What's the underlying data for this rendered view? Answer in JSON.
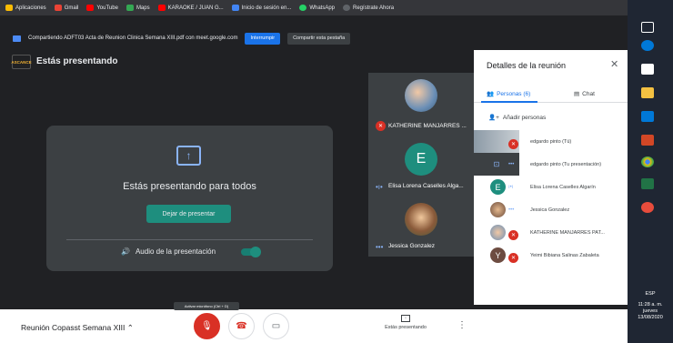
{
  "bookmarks": [
    {
      "label": "Aplicaciones",
      "icon": "apps-grid-icon",
      "color": "#fbbc04"
    },
    {
      "label": "Gmail",
      "icon": "gmail-icon",
      "color": "#ea4335"
    },
    {
      "label": "YouTube",
      "icon": "youtube-icon",
      "color": "#ff0000"
    },
    {
      "label": "Maps",
      "icon": "maps-icon",
      "color": "#34a853"
    },
    {
      "label": "KARAOKE / JUAN G...",
      "icon": "youtube-icon",
      "color": "#ff0000"
    },
    {
      "label": "Inicio de sesión en...",
      "icon": "site-icon",
      "color": "#4285f4"
    },
    {
      "label": "WhatsApp",
      "icon": "whatsapp-icon",
      "color": "#25d366"
    },
    {
      "label": "Regístrate Ahora",
      "icon": "site-icon",
      "color": "#5f6368"
    }
  ],
  "infobar": {
    "message": "Compartiendo ADFT03 Acta de Reunion Clinica Semana XIII.pdf con meet.google.com",
    "stop_label": "Interrumpir",
    "share_tab_label": "Compartir esta pestaña"
  },
  "stage": {
    "brand_label": "ASCANCE",
    "title": "Estás presentando",
    "present_message": "Estás presentando para todos",
    "stop_button": "Dejar de presentar",
    "audio_label": "Audio de la presentación"
  },
  "tiles": [
    {
      "name": "KATHERINE MANJARRES ...",
      "status": "muted"
    },
    {
      "name": "Elisa Lorena Caselles Alga...",
      "initial": "E",
      "status": "speaking"
    },
    {
      "name": "Jessica Gonzalez",
      "status": "active"
    }
  ],
  "panel": {
    "title": "Detalles de la reunión",
    "tab_people": "Personas (6)",
    "tab_chat": "Chat",
    "add_people": "Añadir personas",
    "participants": [
      {
        "name": "edgardo pinto (Tú)",
        "status": "muted"
      },
      {
        "name": "edgardo pinto (Tu presentación)",
        "status": "active"
      },
      {
        "name": "Elisa Lorena Caselles Algarín",
        "initial": "E",
        "status": "speaking"
      },
      {
        "name": "Jessica Gonzalez",
        "status": "active"
      },
      {
        "name": "KATHERINE MANJARRES PAT...",
        "status": "muted"
      },
      {
        "name": "Yeimi Bibiana Salinas Zabaleta",
        "initial": "Y",
        "status": "muted"
      }
    ]
  },
  "bottom": {
    "meeting_name": "Reunión Copasst Semana XIII",
    "mic_tooltip": "Activar micrófono (Ctrl + D)",
    "presenting_label": "Estás presentando"
  },
  "tray": {
    "lang": "ESP",
    "time": "11:28 a. m.",
    "day": "jueves",
    "date": "13/08/2020"
  },
  "colors": {
    "accent": "#1a73e8",
    "teal": "#1e8e7e",
    "danger": "#d93025"
  }
}
